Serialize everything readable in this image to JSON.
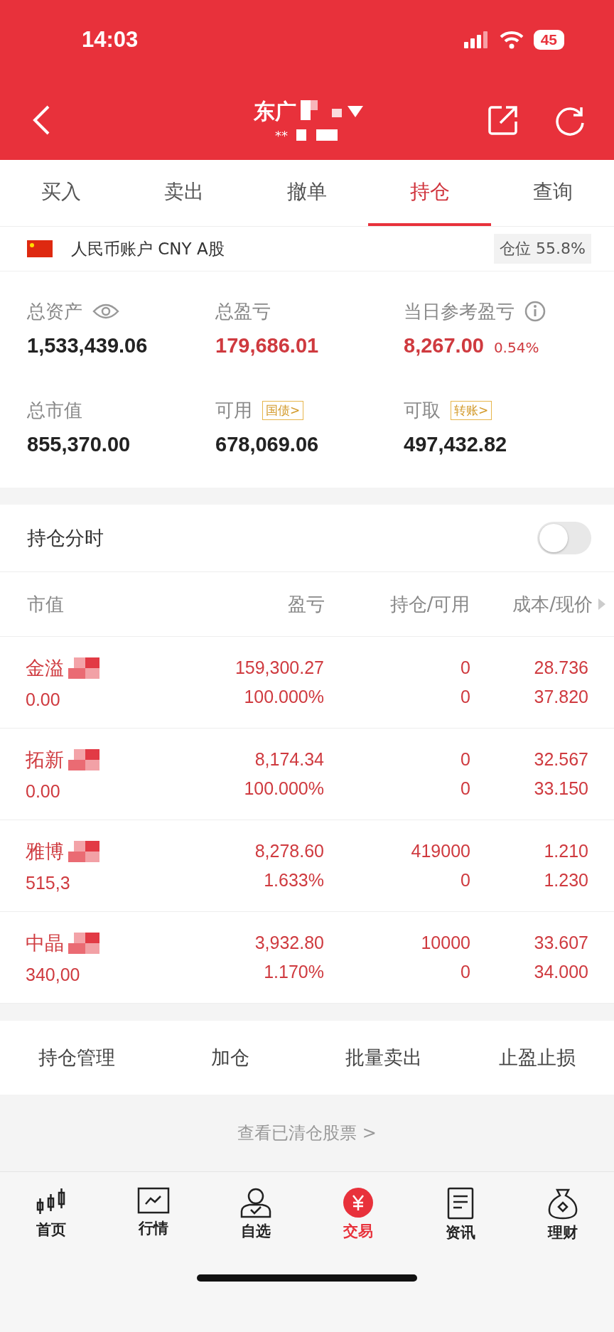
{
  "status_bar": {
    "time": "14:03",
    "battery": "45"
  },
  "header": {
    "title": "东广",
    "subtitle": "**"
  },
  "tabs": [
    {
      "label": "买入",
      "selected": false
    },
    {
      "label": "卖出",
      "selected": false
    },
    {
      "label": "撤单",
      "selected": false
    },
    {
      "label": "持仓",
      "selected": true
    },
    {
      "label": "查询",
      "selected": false
    }
  ],
  "account": {
    "label": "人民币账户 CNY A股",
    "position": "仓位 55.8%"
  },
  "summary": [
    {
      "label": "总资产",
      "kind": "visibility",
      "value": "1,533,439.06",
      "color": "#222222"
    },
    {
      "label": "总盈亏",
      "kind": "plain",
      "value": "179,686.01",
      "color": "#cf3a3f"
    },
    {
      "label": "当日参考盈亏",
      "kind": "hint",
      "value": "8,267.00",
      "extra": "0.54%",
      "color": "#cf3a3f"
    },
    {
      "label": "总市值",
      "kind": "plain",
      "value": "855,370.00",
      "color": "#222222"
    },
    {
      "label": "可用",
      "kind": "link",
      "tag": "国债>",
      "value": "678,069.06",
      "color": "#222222"
    },
    {
      "label": "可取",
      "kind": "link",
      "tag": "转账>",
      "value": "497,432.82",
      "color": "#222222"
    }
  ],
  "intraday": {
    "label": "持仓分时",
    "on": false
  },
  "table": {
    "columns": [
      "市值",
      "盈亏",
      "持仓/可用",
      "成本/现价"
    ],
    "rows": [
      {
        "name": "金溢",
        "value": "0.00",
        "pl": "159,300.27",
        "pct": "100.000%",
        "hold": "0",
        "avail": "0",
        "cost": "28.736",
        "price": "37.820"
      },
      {
        "name": "拓新",
        "value": "0.00",
        "pl": "8,174.34",
        "pct": "100.000%",
        "hold": "0",
        "avail": "0",
        "cost": "32.567",
        "price": "33.150"
      },
      {
        "name": "雅博",
        "value": "515,3",
        "pl": "8,278.60",
        "pct": "1.633%",
        "hold": "419000",
        "avail": "0",
        "cost": "1.210",
        "price": "1.230"
      },
      {
        "name": "中晶",
        "value": "340,00",
        "pl": "3,932.80",
        "pct": "1.170%",
        "hold": "10000",
        "avail": "0",
        "cost": "33.607",
        "price": "34.000"
      }
    ]
  },
  "actions": [
    "持仓管理",
    "加仓",
    "批量卖出",
    "止盈止损"
  ],
  "cleared_link": "查看已清仓股票 >",
  "nav": [
    {
      "label": "首页",
      "selected": false
    },
    {
      "label": "行情",
      "selected": false
    },
    {
      "label": "自选",
      "selected": false
    },
    {
      "label": "交易",
      "selected": true
    },
    {
      "label": "资讯",
      "selected": false
    },
    {
      "label": "理财",
      "selected": false
    }
  ]
}
